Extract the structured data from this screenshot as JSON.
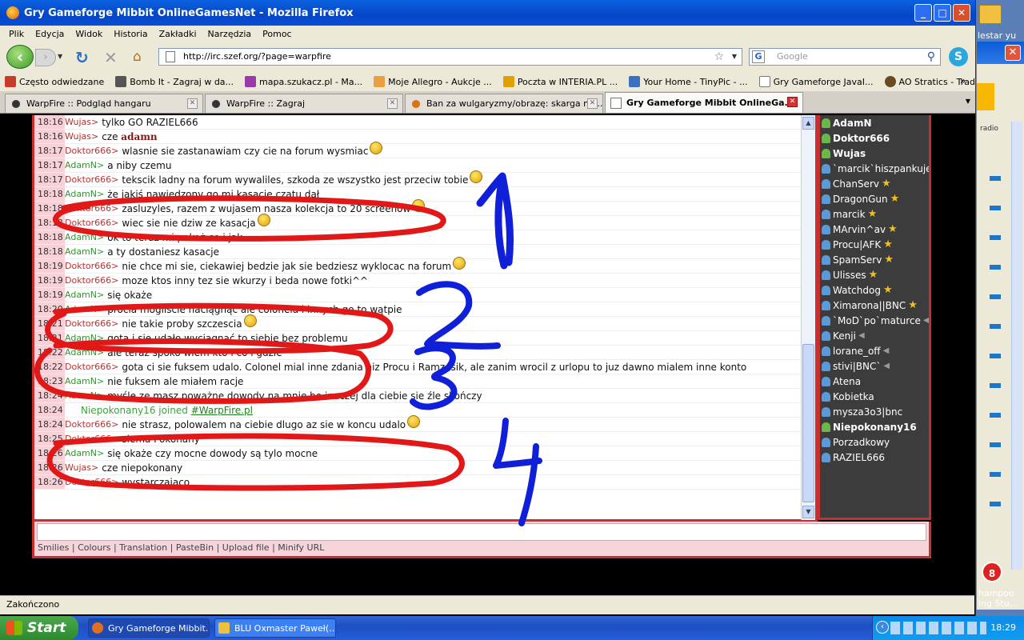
{
  "window": {
    "title": "Gry Gameforge Mibbit OnlineGamesNet - Mozilla Firefox",
    "buttons": {
      "min": "_",
      "max": "□",
      "close": "✕"
    }
  },
  "menu": [
    "Plik",
    "Edycja",
    "Widok",
    "Historia",
    "Zakładki",
    "Narzędzia",
    "Pomoc"
  ],
  "nav": {
    "url": "http://irc.szef.org/?page=warpfire",
    "search_placeholder": "Google",
    "search_engine_label": "G"
  },
  "bookmarks": [
    "Często odwiedzane",
    "Bomb It - Zagraj w da...",
    "mapa.szukacz.pl - Ma...",
    "Moje Allegro - Aukcje ...",
    "Poczta w INTERIA.PL ...",
    "Your Home - TinyPic - ...",
    "Gry Gameforge JavaI...",
    "AO Stratics - Tradeskills"
  ],
  "tabs": [
    {
      "label": "WarpFire :: Podgląd hangaru",
      "active": false
    },
    {
      "label": "WarpFire :: Zagraj",
      "active": false
    },
    {
      "label": "Ban za wulgaryzmy/obrazę: skarga na ...",
      "active": false
    },
    {
      "label": "Gry Gameforge Mibbit OnlineGa...",
      "active": true
    }
  ],
  "messages": [
    {
      "time": "18:16",
      "nick": "Wujas>",
      "type": "wujas",
      "text": "tylko GO RAZIEL666"
    },
    {
      "time": "18:16",
      "nick": "Wujas>",
      "type": "wujas",
      "text": "cze adamn",
      "bold": "adamn"
    },
    {
      "time": "18:17",
      "nick": "Doktor666>",
      "type": "doktor",
      "text": "wlasnie sie zastanawiam czy cie na forum wysmiac",
      "smile": true
    },
    {
      "time": "18:17",
      "nick": "AdamN>",
      "type": "adam",
      "text": "a niby czemu"
    },
    {
      "time": "18:17",
      "nick": "Doktor666>",
      "type": "doktor",
      "text": "tekscik ladny na forum wywaliles, szkoda ze wszystko jest przeciw tobie",
      "smile": true
    },
    {
      "time": "18:18",
      "nick": "AdamN>",
      "type": "adam",
      "text": "że jakiś nawiedzony go mi kasacje czatu dał"
    },
    {
      "time": "18:18",
      "nick": "Doktor666>",
      "type": "doktor",
      "text": "zasluzyles, razem z wujasem nasza kolekcja to 20 screenow",
      "smile": true
    },
    {
      "time": "18:18",
      "nick": "Doktor666>",
      "type": "doktor",
      "text": "wiec sie nie dziw ze kasacja",
      "smile": true
    },
    {
      "time": "18:18",
      "nick": "AdamN>",
      "type": "adam",
      "text": "ok to teraz mi pokaż co i jak"
    },
    {
      "time": "18:18",
      "nick": "AdamN>",
      "type": "adam",
      "text": "a ty dostaniesz kasacje"
    },
    {
      "time": "18:19",
      "nick": "Doktor666>",
      "type": "doktor",
      "text": "nie chce mi sie, ciekawiej bedzie jak sie bedziesz wyklocac na forum",
      "smile": true
    },
    {
      "time": "18:19",
      "nick": "Doktor666>",
      "type": "doktor",
      "text": "moze ktos inny tez sie wkurzy i beda nowe fotki^^"
    },
    {
      "time": "18:19",
      "nick": "AdamN>",
      "type": "adam",
      "text": "się okaże"
    },
    {
      "time": "18:20",
      "nick": "AdamN>",
      "type": "adam",
      "text": "procia mogliście naciągnąć ale colonela i innych go to wątpie"
    },
    {
      "time": "18:21",
      "nick": "Doktor666>",
      "type": "doktor",
      "text": "nie takie proby szczescia",
      "smile": true
    },
    {
      "time": "18:21",
      "nick": "AdamN>",
      "type": "adam",
      "text": "gota i sie udało wyciągnąć to siebie bez problemu"
    },
    {
      "time": "18:22",
      "nick": "AdamN>",
      "type": "adam",
      "text": "ale teraz spoko wiem kto i co i gdzie"
    },
    {
      "time": "18:22",
      "nick": "Doktor666>",
      "type": "doktor",
      "text": "gota ci sie fuksem udalo. Colonel mial inne zdania niz Procu i Ramzesik, ale zanim wrocil z urlopu to juz dawno mialem inne konto"
    },
    {
      "time": "18:23",
      "nick": "AdamN>",
      "type": "adam",
      "text": "nie fuksem ale miałem racje"
    },
    {
      "time": "18:24",
      "nick": "AdamN>",
      "type": "adam",
      "text": "myśle ze masz poważne dowody na mnie bo inaczej dla ciebie sie źle skończy"
    },
    {
      "time": "18:24",
      "nick": "",
      "type": "join",
      "text": "Niepokonany16 joined ",
      "channel": "#WarpFire.pl"
    },
    {
      "time": "18:24",
      "nick": "Doktor666>",
      "type": "doktor",
      "text": "nie strasz, polowalem na ciebie dlugo az sie w koncu udalo",
      "smile": true
    },
    {
      "time": "18:25",
      "nick": "Doktor666>",
      "type": "doktor",
      "text": "siema Pokonany"
    },
    {
      "time": "18:26",
      "nick": "AdamN>",
      "type": "adam",
      "text": "się okaże czy mocne dowody są tylo mocne"
    },
    {
      "time": "18:26",
      "nick": "Wujas>",
      "type": "wujas",
      "text": "cze niepokonany"
    },
    {
      "time": "18:26",
      "nick": "Doktor666>",
      "type": "doktor",
      "text": "wystarczajaco"
    }
  ],
  "users": [
    {
      "name": "AdamN",
      "op": true,
      "star": false,
      "mute": false
    },
    {
      "name": "Doktor666",
      "op": true,
      "star": false,
      "mute": false
    },
    {
      "name": "Wujas",
      "op": true,
      "star": false,
      "mute": false
    },
    {
      "name": "`marcik`hiszpankuje",
      "op": false,
      "star": true,
      "mute": false
    },
    {
      "name": "ChanServ",
      "op": false,
      "star": true,
      "mute": false
    },
    {
      "name": "DragonGun",
      "op": false,
      "star": true,
      "mute": false
    },
    {
      "name": "marcik",
      "op": false,
      "star": true,
      "mute": false
    },
    {
      "name": "MArvin^av",
      "op": false,
      "star": true,
      "mute": false
    },
    {
      "name": "Procu|AFK",
      "op": false,
      "star": true,
      "mute": false
    },
    {
      "name": "SpamServ",
      "op": false,
      "star": true,
      "mute": false
    },
    {
      "name": "Ulisses",
      "op": false,
      "star": true,
      "mute": false
    },
    {
      "name": "Watchdog",
      "op": false,
      "star": true,
      "mute": false
    },
    {
      "name": "Ximarona||BNC",
      "op": false,
      "star": true,
      "mute": false
    },
    {
      "name": "`MoD`po`maturce",
      "op": false,
      "star": false,
      "mute": true
    },
    {
      "name": "Kenji",
      "op": false,
      "star": false,
      "mute": true
    },
    {
      "name": "lorane_off",
      "op": false,
      "star": false,
      "mute": true
    },
    {
      "name": "stivi|BNC`",
      "op": false,
      "star": false,
      "mute": true
    },
    {
      "name": "Atena",
      "op": false,
      "star": false,
      "mute": false
    },
    {
      "name": "Kobietka",
      "op": false,
      "star": false,
      "mute": false
    },
    {
      "name": "mysza3o3|bnc",
      "op": false,
      "star": false,
      "mute": false
    },
    {
      "name": "Niepokonany16",
      "op": true,
      "star": false,
      "mute": false
    },
    {
      "name": "Porzadkowy",
      "op": false,
      "star": false,
      "mute": false
    },
    {
      "name": "RAZIEL666",
      "op": false,
      "star": false,
      "mute": false
    }
  ],
  "chat_toolbar": "Smilies | Colours | Translation | PasteBin | Upload file | Minify URL",
  "annotations": {
    "labels": [
      "1",
      "2",
      "3",
      "4"
    ],
    "ellipse_color": "#e01818",
    "number_color": "#1020d8"
  },
  "status": "Zakończono",
  "desktop": {
    "label": "lestar yu",
    "badge": "8",
    "side_text_1": "hampoo",
    "side_text_2": "ing Stu...",
    "radio": "radio"
  },
  "taskbar": {
    "start": "Start",
    "tasks": [
      "Gry Gameforge Mibbit...",
      "BLU Oxmaster Paweł(..."
    ],
    "clock": "18:29"
  }
}
